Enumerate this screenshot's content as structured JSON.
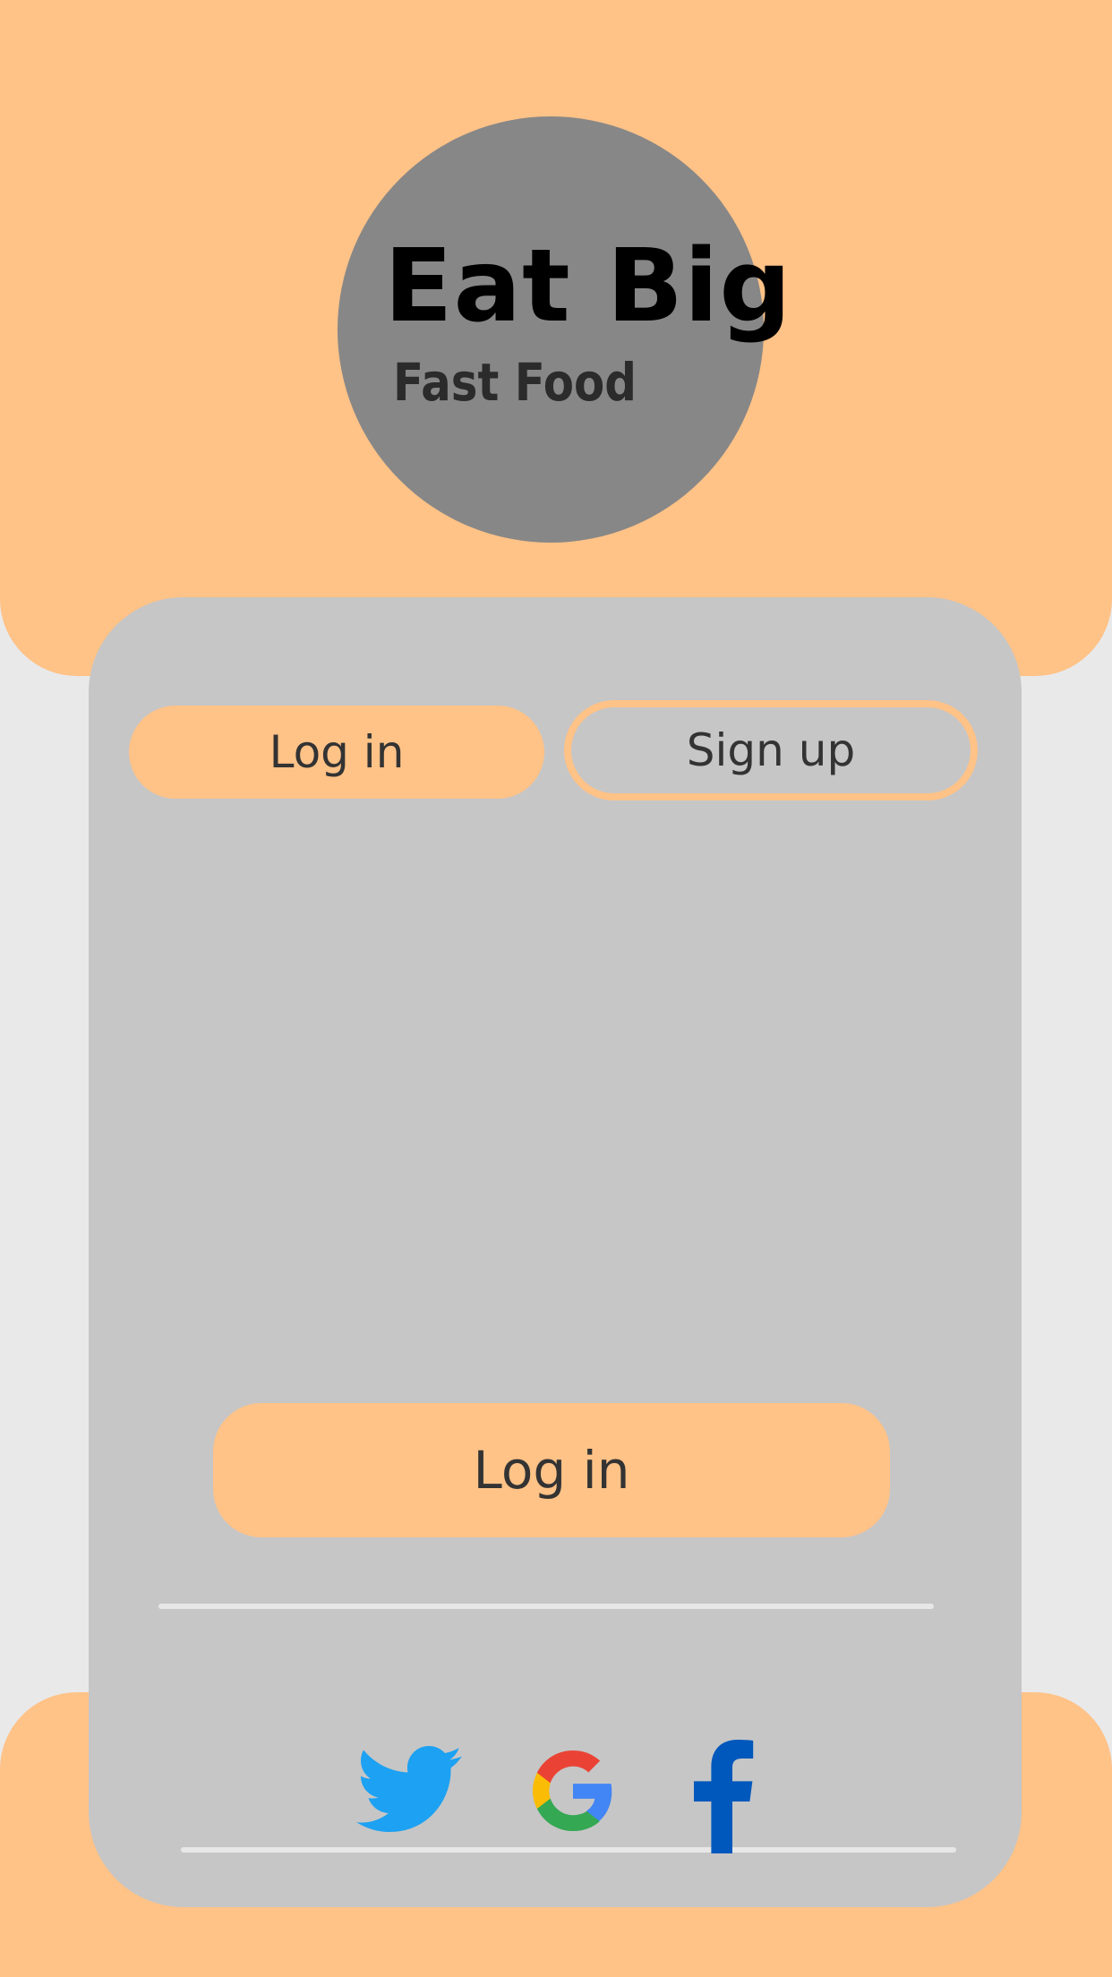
{
  "brand": {
    "title": "Eat Big",
    "subtitle": "Fast Food"
  },
  "tabs": {
    "login_label": "Log in",
    "signup_label": "Sign up"
  },
  "form": {
    "username_value": "",
    "password_value": "",
    "submit_label": "Log in"
  },
  "social": {
    "icons": [
      "twitter-icon",
      "google-icon",
      "facebook-icon"
    ]
  },
  "colors": {
    "accent": "#ffc287",
    "card": "#c6c6c6",
    "logo_circle": "#878787",
    "twitter": "#1da1f2",
    "facebook": "#0058bc"
  }
}
